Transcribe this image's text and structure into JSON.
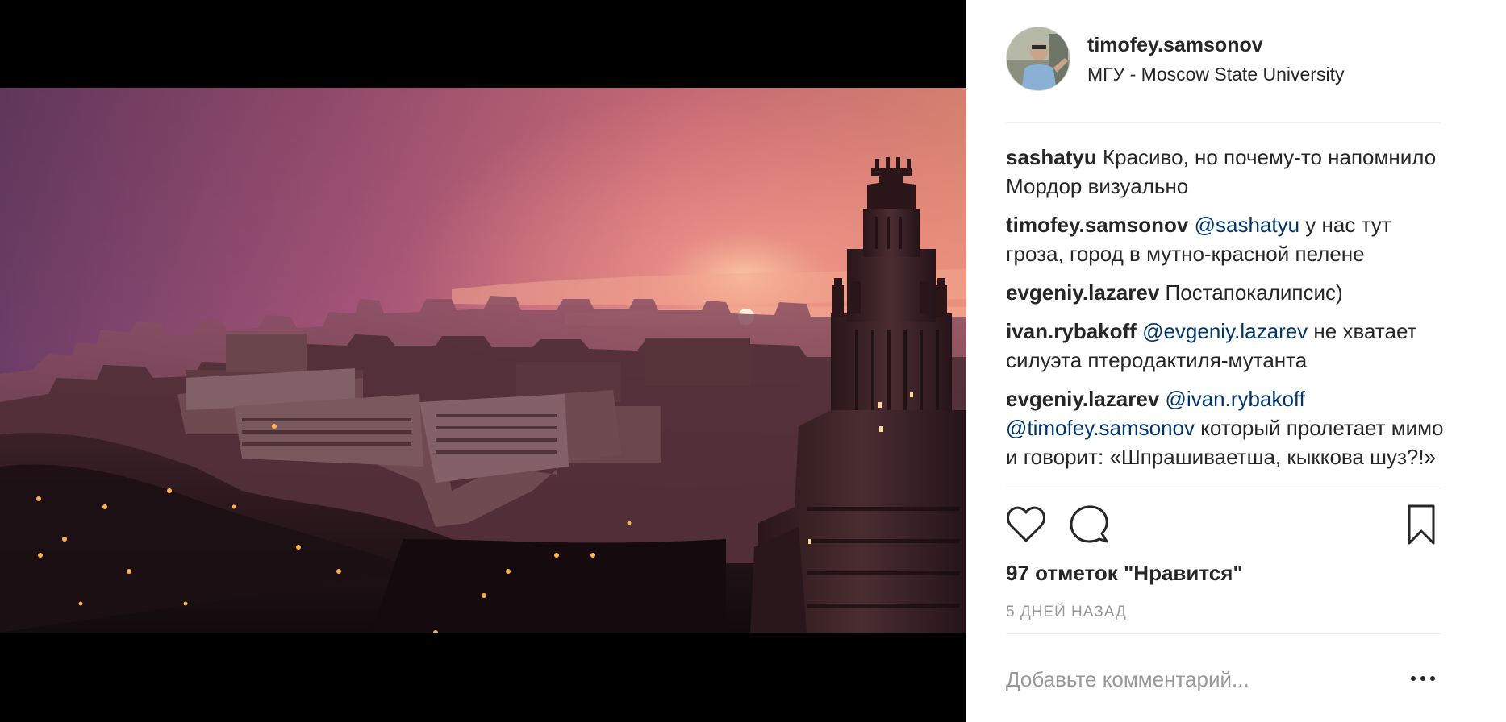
{
  "header": {
    "username": "timofey.samsonov",
    "location": "МГУ - Moscow State University"
  },
  "comments": [
    {
      "author": "sashatyu",
      "parts": [
        {
          "type": "text",
          "value": "Красиво, но почему-то напомнило Мордор визуально"
        }
      ]
    },
    {
      "author": "timofey.samsonov",
      "parts": [
        {
          "type": "mention",
          "value": "@sashatyu"
        },
        {
          "type": "text",
          "value": "у нас тут гроза, город в мутно-красной пелене"
        }
      ]
    },
    {
      "author": "evgeniy.lazarev",
      "parts": [
        {
          "type": "text",
          "value": "Постапокалипсис)"
        }
      ]
    },
    {
      "author": "ivan.rybakoff",
      "parts": [
        {
          "type": "mention",
          "value": "@evgeniy.lazarev"
        },
        {
          "type": "text",
          "value": "не хватает силуэта птеродактиля-мутанта"
        }
      ]
    },
    {
      "author": "evgeniy.lazarev",
      "parts": [
        {
          "type": "mention",
          "value": "@ivan.rybakoff"
        },
        {
          "type": "mention",
          "value": "@timofey.samsonov"
        },
        {
          "type": "text",
          "value": "который пролетает мимо и говорит: «Шпрашиваетша, кыккова шуз?!»"
        }
      ]
    }
  ],
  "actions": {
    "like_icon": "heart-icon",
    "comment_icon": "speech-bubble-icon",
    "save_icon": "bookmark-icon"
  },
  "likes": "97 отметок \"Нравится\"",
  "time": "5 ДНЕЙ НАЗАД",
  "add_comment": {
    "placeholder": "Добавьте комментарий...",
    "more_icon": "ellipsis-icon"
  },
  "colors": {
    "text": "#262626",
    "mention": "#003569",
    "muted": "#999999",
    "divider": "#efefef"
  }
}
